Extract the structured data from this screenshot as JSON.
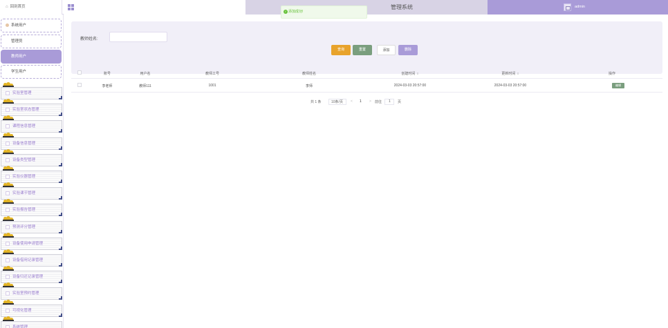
{
  "header": {
    "home_label": "回到首页",
    "system_title": "管理系统",
    "user_name": "admin"
  },
  "toast": {
    "message": "添加成功!"
  },
  "sidebar": {
    "user_items": [
      "系统用户",
      "管理员",
      "教师用户",
      "学生用户"
    ],
    "active_index": 2,
    "menus": [
      "实验室管理",
      "实验室状态管理",
      "课程信息管理",
      "设备信息管理",
      "设备类型管理",
      "实验仪器管理",
      "实验课节管理",
      "实验报告管理",
      "预测评分管理",
      "设备使用申请管理",
      "设备借用记录管理",
      "设备归还记录管理",
      "实验室预约管理",
      "可视化管理",
      "系统管理"
    ]
  },
  "search": {
    "label": "教师姓名:",
    "value": "",
    "buttons": {
      "query": "查询",
      "reset": "重置",
      "add": "添加",
      "delete": "删除"
    }
  },
  "table": {
    "headers": [
      "账号",
      "用户名",
      "教师工号",
      "教师姓名",
      "创建时间",
      "更新时间",
      "操作"
    ],
    "rows": [
      {
        "account": "李老师",
        "username": "教师111",
        "teacher_no": "1001",
        "teacher_name": "李师",
        "created": "2024-03-03 20:57:00",
        "updated": "2024-03-03 20:57:00",
        "action": "编辑"
      }
    ]
  },
  "pagination": {
    "total": "共 1 条",
    "per_page": "10条/页",
    "prev": "<",
    "current": "1",
    "next": ">",
    "goto": "前往",
    "goto_value": "1",
    "page_unit": "页"
  },
  "colors": {
    "accent": "#a99bd8",
    "title_bg": "#d8d3e5",
    "query": "#e8a32c",
    "reset": "#7a9e7e",
    "success": "#67c23a"
  }
}
